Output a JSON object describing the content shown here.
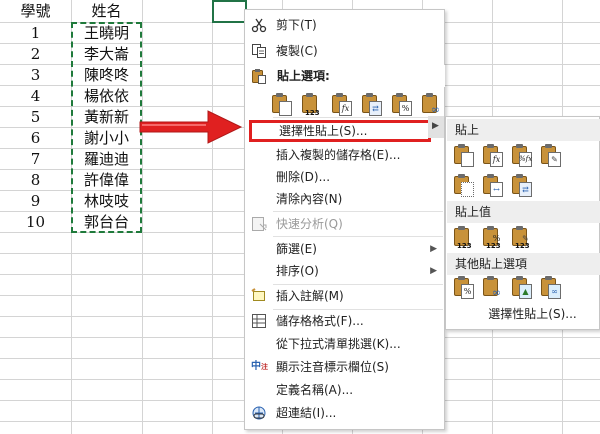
{
  "sheet": {
    "headers": [
      "學號",
      "姓名"
    ],
    "rows": [
      {
        "id": "1",
        "name": "王曉明"
      },
      {
        "id": "2",
        "name": "李大崙"
      },
      {
        "id": "3",
        "name": "陳咚咚"
      },
      {
        "id": "4",
        "name": "楊依依"
      },
      {
        "id": "5",
        "name": "黃新新"
      },
      {
        "id": "6",
        "name": "謝小小"
      },
      {
        "id": "7",
        "name": "羅迪迪"
      },
      {
        "id": "8",
        "name": "許偉偉"
      },
      {
        "id": "9",
        "name": "林吱吱"
      },
      {
        "id": "10",
        "name": "郭台台"
      }
    ]
  },
  "context_menu": {
    "cut": "剪下(T)",
    "copy": "複製(C)",
    "paste_options_header": "貼上選項:",
    "paste_special": "選擇性貼上(S)...",
    "insert_copied": "插入複製的儲存格(E)...",
    "delete": "刪除(D)...",
    "clear_contents": "清除內容(N)",
    "quick_analysis": "快速分析(Q)",
    "filter": "篩選(E)",
    "sort": "排序(O)",
    "insert_comment": "插入註解(M)",
    "format_cells": "儲存格格式(F)...",
    "pick_from_list": "從下拉式清單挑選(K)...",
    "show_phonetic": "顯示注音標示欄位(S)",
    "define_name": "定義名稱(A)...",
    "hyperlink": "超連結(I)..."
  },
  "submenu": {
    "paste_header": "貼上",
    "paste_values_header": "貼上值",
    "other_paste_header": "其他貼上選項",
    "paste_special_footer": "選擇性貼上(S)..."
  },
  "icons": {
    "cut": "scissors-icon",
    "copy": "copy-icon",
    "paste": "clipboard-icon",
    "quick_analysis": "quick-analysis-icon",
    "insert_comment": "comment-icon",
    "format_cells": "format-cells-icon",
    "show_phonetic": "phonetic-icon",
    "hyperlink": "link-icon"
  },
  "paste_glyphs": {
    "formulas": "fx",
    "values": "123",
    "percent": "%"
  },
  "colors": {
    "highlight_border": "#e02020",
    "arrow": "#e02020",
    "copy_marquee": "#1f7a3b",
    "active_cell": "#217346"
  }
}
